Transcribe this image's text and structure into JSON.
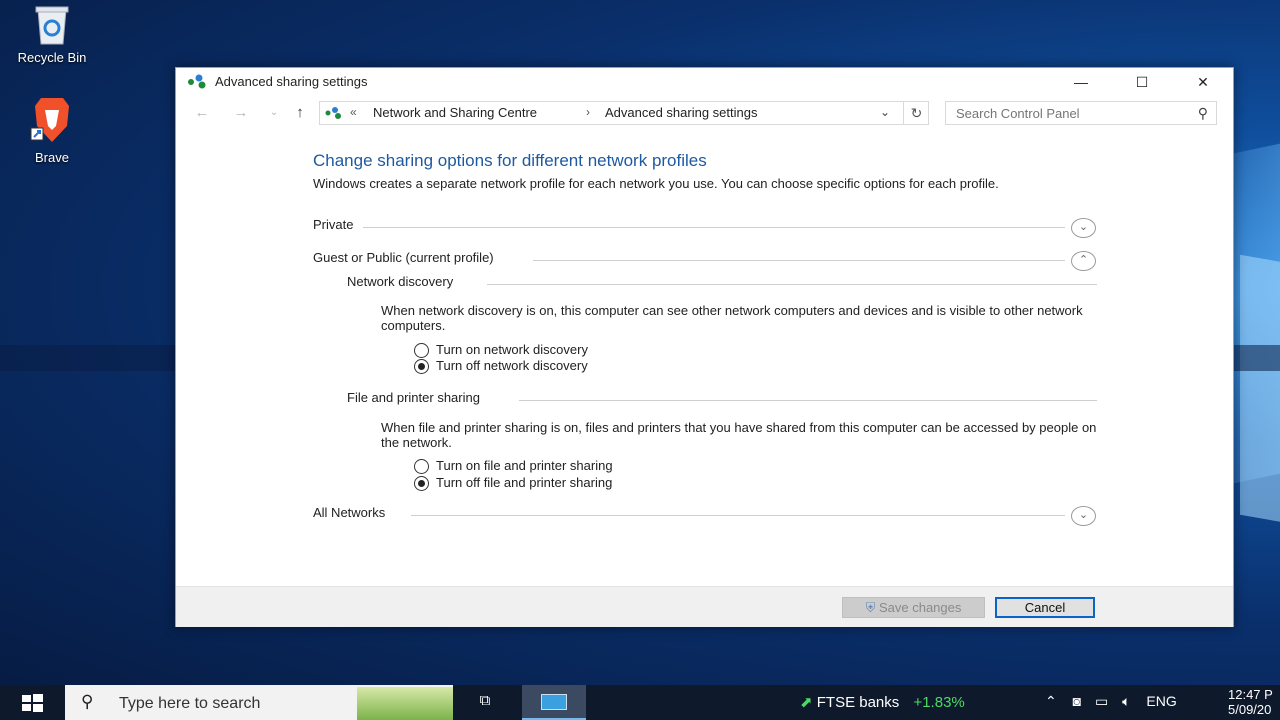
{
  "desktop": {
    "icons": [
      {
        "label": "Recycle Bin"
      },
      {
        "label": "Brave"
      }
    ]
  },
  "window": {
    "title": "Advanced sharing settings",
    "controls": {
      "minimize": "—",
      "maximize": "☐",
      "close": "✕"
    }
  },
  "address": {
    "chevrons": "«",
    "crumb1": "Network and Sharing Centre",
    "separator": "›",
    "crumb2": "Advanced sharing settings"
  },
  "search": {
    "placeholder": "Search Control Panel"
  },
  "content": {
    "heading": "Change sharing options for different network profiles",
    "intro": "Windows creates a separate network profile for each network you use. You can choose specific options for each profile.",
    "private_label": "Private",
    "guest_label": "Guest or Public (current profile)",
    "network_discovery": {
      "label": "Network discovery",
      "description": "When network discovery is on, this computer can see other network computers and devices and is visible to other network computers.",
      "options": [
        {
          "label": "Turn on network discovery",
          "selected": false
        },
        {
          "label": "Turn off network discovery",
          "selected": true
        }
      ]
    },
    "file_sharing": {
      "label": "File and printer sharing",
      "description": "When file and printer sharing is on, files and printers that you have shared from this computer can be accessed by people on the network.",
      "options": [
        {
          "label": "Turn on file and printer sharing",
          "selected": false
        },
        {
          "label": "Turn off file and printer sharing",
          "selected": true
        }
      ]
    },
    "all_networks_label": "All Networks"
  },
  "footer": {
    "save_label": "Save changes",
    "cancel_label": "Cancel"
  },
  "taskbar": {
    "search_placeholder": "Type here to search",
    "ticker_name": "FTSE banks",
    "ticker_change": "+1.83%",
    "language": "ENG",
    "time": "12:47 P",
    "date": "5/09/20"
  }
}
